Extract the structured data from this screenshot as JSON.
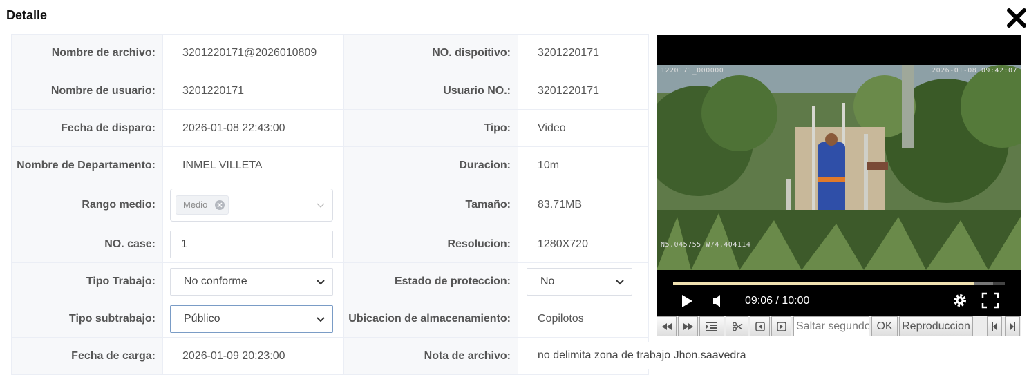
{
  "dialog": {
    "title": "Detalle"
  },
  "fields": {
    "file_name": {
      "label": "Nombre de archivo:",
      "value": "3201220171@2026010809"
    },
    "device_no": {
      "label": "NO. dispoitivo:",
      "value": "3201220171"
    },
    "user_name": {
      "label": "Nombre de usuario:",
      "value": "3201220171"
    },
    "user_no": {
      "label": "Usuario NO.:",
      "value": "3201220171"
    },
    "shot_date": {
      "label": "Fecha de disparo:",
      "value": "2026-01-08 22:43:00"
    },
    "type": {
      "label": "Tipo:",
      "value": "Video"
    },
    "department": {
      "label": "Nombre de Departamento:",
      "value": "INMEL VILLETA"
    },
    "duration": {
      "label": "Duracion:",
      "value": "10m"
    },
    "media_range": {
      "label": "Rango medio:",
      "tag": "Medio"
    },
    "size": {
      "label": "Tamaño:",
      "value": "83.71MB"
    },
    "case_no": {
      "label": "NO. case:",
      "value": "1"
    },
    "resolution": {
      "label": "Resolucion:",
      "value": "1280X720"
    },
    "work_type": {
      "label": "Tipo Trabajo:",
      "value": "No conforme"
    },
    "protection": {
      "label": "Estado de proteccion:",
      "value": "No"
    },
    "subwork_type": {
      "label": "Tipo subtrabajo:",
      "value": "Público"
    },
    "storage": {
      "label": "Ubicacion de almacenamiento:",
      "value": "Copilotos"
    },
    "upload_date": {
      "label": "Fecha de carga:",
      "value": "2026-01-09 20:23:00"
    },
    "note": {
      "label": "Nota de archivo:",
      "value": "no delimita zona de trabajo Jhon.saavedra"
    }
  },
  "video": {
    "osd_top_left": "1220171_000000",
    "osd_top_right": "2026-01-08 09:42:07",
    "osd_bottom_left": "N5.045755 W74.404114",
    "current_time": "09:06",
    "total_time": "10:00",
    "time_display": "09:06 / 10:00",
    "played_fraction": 0.906,
    "buffered_fraction": 0.965
  },
  "toolbar": {
    "skip_placeholder": "Saltar segundos",
    "ok_label": "OK",
    "playback_label": "Reproduccion"
  }
}
